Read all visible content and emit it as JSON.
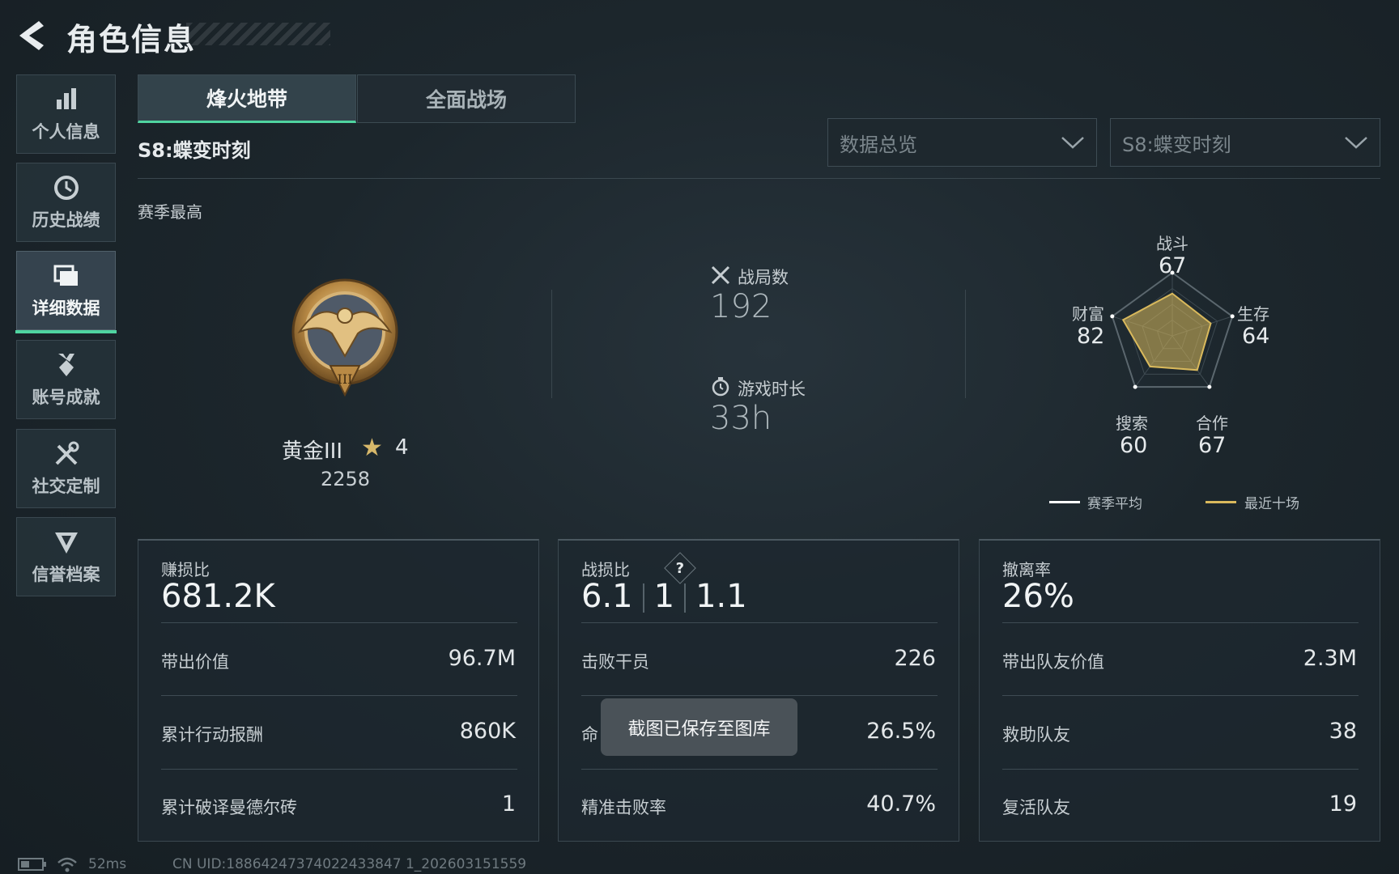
{
  "header": {
    "title": "角色信息"
  },
  "sidebar": {
    "items": [
      {
        "label": "个人信息",
        "icon": "bar-chart-icon"
      },
      {
        "label": "历史战绩",
        "icon": "history-clock-icon"
      },
      {
        "label": "详细数据",
        "icon": "cards-icon",
        "active": true
      },
      {
        "label": "账号成就",
        "icon": "medal-icon"
      },
      {
        "label": "社交定制",
        "icon": "tools-icon"
      },
      {
        "label": "信誉档案",
        "icon": "shield-icon"
      }
    ]
  },
  "tabs": [
    {
      "label": "烽火地带",
      "active": true
    },
    {
      "label": "全面战场",
      "active": false
    }
  ],
  "season_label": "S8:蝶变时刻",
  "dropdowns": {
    "category": "数据总览",
    "season": "S8:蝶变时刻"
  },
  "overview": {
    "section_title": "赛季最高",
    "rank": {
      "name": "黄金III",
      "stars": "4",
      "score": "2258",
      "badge_numeral": "III"
    },
    "matches": {
      "label": "战局数",
      "value": "192"
    },
    "playtime": {
      "label": "游戏时长",
      "value": "33h"
    },
    "radar": {
      "axes": [
        {
          "label": "战斗",
          "value": 67
        },
        {
          "label": "生存",
          "value": 64
        },
        {
          "label": "合作",
          "value": 67
        },
        {
          "label": "搜索",
          "value": 60
        },
        {
          "label": "财富",
          "value": 82
        }
      ],
      "legend": [
        {
          "label": "赛季平均",
          "color": "#ffffff"
        },
        {
          "label": "最近十场",
          "color": "#d9b95c"
        }
      ]
    }
  },
  "panels": [
    {
      "title": "赚损比",
      "main": "681.2K",
      "rows": [
        {
          "label": "带出价值",
          "value": "96.7M"
        },
        {
          "label": "累计行动报酬",
          "value": "860K"
        },
        {
          "label": "累计破译曼德尔砖",
          "value": "1"
        }
      ]
    },
    {
      "title": "战损比",
      "help": "?",
      "main_parts": [
        "6.1",
        "1",
        "1.1"
      ],
      "rows": [
        {
          "label": "击败干员",
          "value": "226"
        },
        {
          "label": "命",
          "value": "26.5%"
        },
        {
          "label": "精准击败率",
          "value": "40.7%"
        }
      ]
    },
    {
      "title": "撤离率",
      "main": "26%",
      "rows": [
        {
          "label": "带出队友价值",
          "value": "2.3M"
        },
        {
          "label": "救助队友",
          "value": "38"
        },
        {
          "label": "复活队友",
          "value": "19"
        }
      ]
    }
  ],
  "toast": "截图已保存至图库",
  "status": {
    "ping": "52ms",
    "uid": "CN UID:18864247374022433847 1_202603151559"
  },
  "colors": {
    "accent": "#4fd4a0",
    "gold": "#d9b95c"
  }
}
